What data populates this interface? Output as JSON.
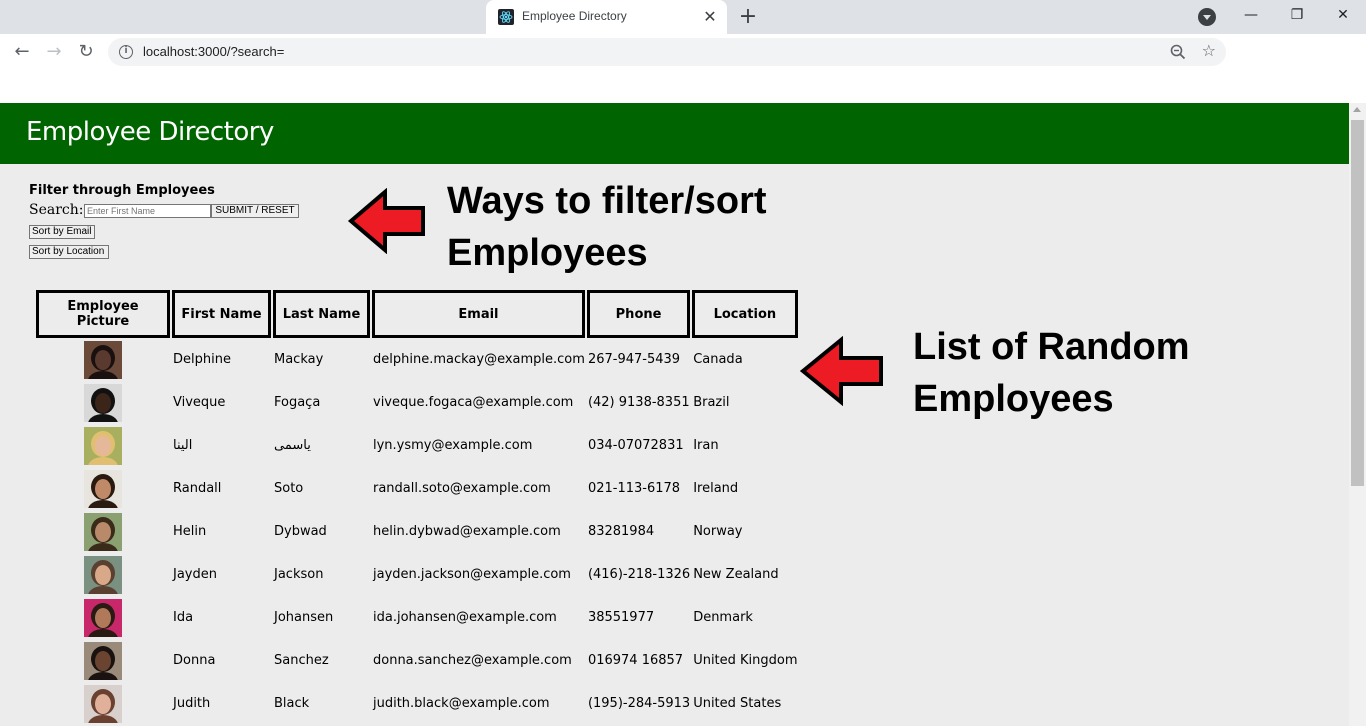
{
  "browser": {
    "tab_title": "Employee Directory",
    "url": "localhost:3000/?search="
  },
  "header": {
    "title": "Employee Directory"
  },
  "filters": {
    "heading": "Filter through Employees",
    "search_label": "Search:",
    "search_placeholder": "Enter First Name",
    "search_value": "",
    "submit_label": "SUBMIT / RESET",
    "sort_email_label": "Sort by Email",
    "sort_location_label": "Sort by Location"
  },
  "annotations": {
    "filter_line1": "Ways to filter/sort",
    "filter_line2": "Employees",
    "list_line1": "List of Random",
    "list_line2": "Employees",
    "arrow_color": "#ed1c24"
  },
  "table": {
    "headers": [
      "Employee Picture",
      "First Name",
      "Last Name",
      "Email",
      "Phone",
      "Location"
    ],
    "rows": [
      {
        "first": "Delphine",
        "last": "Mackay",
        "email": "delphine.mackay@example.com",
        "phone": "267-947-5439",
        "location": "Canada",
        "skin": "#5a3a2e",
        "hair": "#1a1010",
        "bg": "#6b4a3a"
      },
      {
        "first": "Viveque",
        "last": "Fogaça",
        "email": "viveque.fogaca@example.com",
        "phone": "(42) 9138-8351",
        "location": "Brazil",
        "skin": "#3b2418",
        "hair": "#111111",
        "bg": "#d8d8d8"
      },
      {
        "first": "الینا",
        "last": "یاسمی",
        "email": "lyn.ysmy@example.com",
        "phone": "034-07072831",
        "location": "Iran",
        "skin": "#e6b89a",
        "hair": "#e0c070",
        "bg": "#a8b060"
      },
      {
        "first": "Randall",
        "last": "Soto",
        "email": "randall.soto@example.com",
        "phone": "021-113-6178",
        "location": "Ireland",
        "skin": "#c08a68",
        "hair": "#2a1a10",
        "bg": "#e8e4de"
      },
      {
        "first": "Helin",
        "last": "Dybwad",
        "email": "helin.dybwad@example.com",
        "phone": "83281984",
        "location": "Norway",
        "skin": "#b88a6a",
        "hair": "#3a2a1a",
        "bg": "#8aa070"
      },
      {
        "first": "Jayden",
        "last": "Jackson",
        "email": "jayden.jackson@example.com",
        "phone": "(416)-218-1326",
        "location": "New Zealand",
        "skin": "#d8a888",
        "hair": "#5a4030",
        "bg": "#7a9080"
      },
      {
        "first": "Ida",
        "last": "Johansen",
        "email": "ida.johansen@example.com",
        "phone": "38551977",
        "location": "Denmark",
        "skin": "#b07a5a",
        "hair": "#2a1a14",
        "bg": "#c8286a"
      },
      {
        "first": "Donna",
        "last": "Sanchez",
        "email": "donna.sanchez@example.com",
        "phone": "016974 16857",
        "location": "United Kingdom",
        "skin": "#6a4430",
        "hair": "#1a1210",
        "bg": "#9a8a7a"
      },
      {
        "first": "Judith",
        "last": "Black",
        "email": "judith.black@example.com",
        "phone": "(195)-284-5913",
        "location": "United States",
        "skin": "#e0b09a",
        "hair": "#6a4030",
        "bg": "#d8d0cc"
      }
    ]
  },
  "colors": {
    "header_bg": "#006400",
    "page_bg": "#ececec"
  }
}
